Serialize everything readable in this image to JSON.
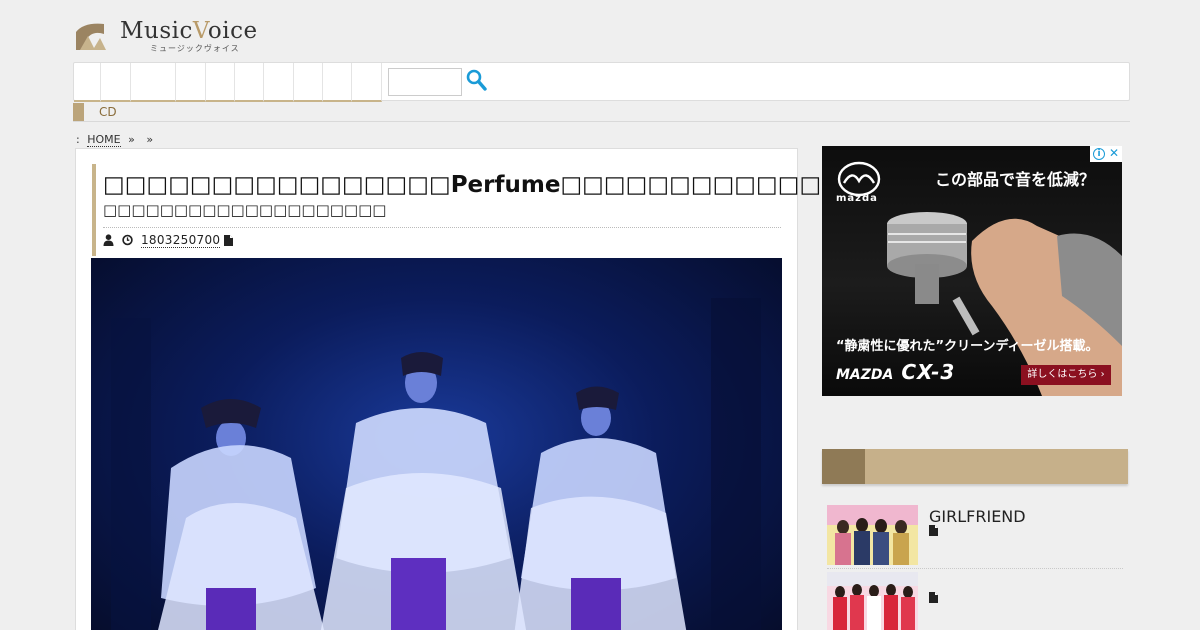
{
  "site": {
    "logo_name": "MusicVoice",
    "logo_name_a": "Music",
    "logo_name_v": "V",
    "logo_name_b": "oice",
    "logo_sub": "ミュージックヴォイス"
  },
  "nav": {
    "items": [
      "",
      "",
      "",
      "",
      "",
      "",
      "",
      "",
      "",
      ""
    ],
    "search_placeholder": ""
  },
  "category": {
    "label": "CD"
  },
  "breadcrumb": {
    "prefix": ":",
    "home": "HOME",
    "sep": "»"
  },
  "article": {
    "title_a": "□□□□□□□□□□□□□□□□",
    "title_b": "Perfume",
    "title_c": "□□□□□□□□□□□□",
    "subtitle": "□□□□□□□□□□□□□□□□□□□□",
    "date": "1803250700"
  },
  "ad": {
    "brand_word": "mazda",
    "headline": "この部品で音を低減？",
    "copy": "“静粛性に優れた”クリーンディーゼル搭載。",
    "model_a": "MAZDA",
    "model_b": "CX-3",
    "cta": "詳しくはこちら ›",
    "info": "i",
    "close": "✕"
  },
  "sidebar": {
    "items": [
      {
        "title": "GIRLFRIEND"
      },
      {
        "title": ""
      }
    ]
  },
  "colors": {
    "accent": "#c8b48a",
    "accent_dark": "#8f7a56",
    "page_bg": "#efefef",
    "search_icon": "#1a9bd7"
  }
}
